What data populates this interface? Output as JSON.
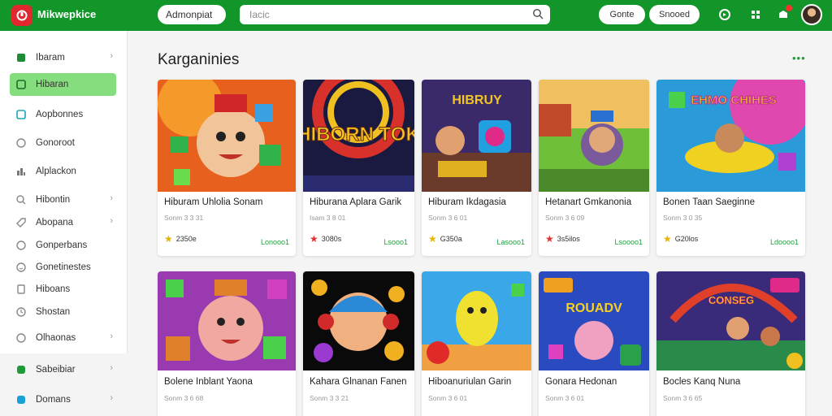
{
  "header": {
    "logo_text": "Mikwepkice",
    "selector_label": "Admonpiat",
    "search_placeholder": "Iacic",
    "btn_a": "Gonte",
    "btn_b": "Snooed"
  },
  "sidebar": {
    "items": [
      {
        "label": "Ibaram",
        "icon": "puzzle-icon",
        "chevron": true,
        "active": false
      },
      {
        "label": "Hibaran",
        "icon": "gamepad-icon",
        "chevron": false,
        "active": true
      },
      {
        "label": "Aopbonnes",
        "icon": "grid-icon",
        "chevron": false,
        "active": false
      },
      {
        "label": "Gonoroot",
        "icon": "circle-icon",
        "chevron": false,
        "active": false
      },
      {
        "label": "Alplackon",
        "icon": "chart-icon",
        "chevron": false,
        "active": false
      },
      {
        "label": "Hibontin",
        "icon": "search-icon",
        "chevron": true,
        "active": false
      },
      {
        "label": "Abopana",
        "icon": "tag-icon",
        "chevron": true,
        "active": false
      },
      {
        "label": "Gonperbans",
        "icon": "circle-icon",
        "chevron": false,
        "active": false
      },
      {
        "label": "Gonetinestes",
        "icon": "smile-icon",
        "chevron": false,
        "active": false
      },
      {
        "label": "Hiboans",
        "icon": "doc-icon",
        "chevron": false,
        "active": false
      },
      {
        "label": "Shostan",
        "icon": "clock-icon",
        "chevron": false,
        "active": false
      },
      {
        "label": "Olhaonas",
        "icon": "circle-icon",
        "chevron": true,
        "active": false
      },
      {
        "label": "Sabeibiar",
        "icon": "green-dot-icon",
        "chevron": true,
        "active": false
      },
      {
        "label": "Domans",
        "icon": "blue-dot-icon",
        "chevron": true,
        "active": false
      }
    ]
  },
  "main": {
    "section_title": "Karganinies",
    "cards": [
      {
        "title": "Hiburam Uhlolia Sonam",
        "sub": "Sonm 3 3 31",
        "rating": "2350e",
        "star": "gold",
        "price": "Lonooo1"
      },
      {
        "title": "Hiburana Aplara Garik",
        "sub": "Isam 3 8 01",
        "rating": "3080s",
        "star": "red",
        "price": "Lsooo1"
      },
      {
        "title": "Hiburam Ikdagasia",
        "sub": "Sonm 3 6 01",
        "rating": "G350a",
        "star": "gold",
        "price": "Lasooo1"
      },
      {
        "title": "Hetanart Gmkanonia",
        "sub": "Sonm 3 6 09",
        "rating": "3s5ilos",
        "star": "red",
        "price": "Lsoooo1"
      },
      {
        "title": "Bonen Taan Saeginne",
        "sub": "Sonm 3 0 35",
        "rating": "G20los",
        "star": "gold",
        "price": "Ldoooo1"
      },
      {
        "title": "Bolene Inblant Yaona",
        "sub": "Sonm 3 6 68",
        "rating": "",
        "star": "",
        "price": ""
      },
      {
        "title": "Kahara Glnanan Fanen",
        "sub": "Sonm 3 3 21",
        "rating": "",
        "star": "",
        "price": ""
      },
      {
        "title": "Hiboanuriulan Garin",
        "sub": "Sonm 3 6 01",
        "rating": "",
        "star": "",
        "price": ""
      },
      {
        "title": "Gonara Hedonan",
        "sub": "Sonm 3 6 01",
        "rating": "",
        "star": "",
        "price": ""
      },
      {
        "title": "Bocles Kanq Nuna",
        "sub": "Sonm 3 6 65",
        "rating": "",
        "star": "",
        "price": ""
      }
    ],
    "thumb_texts": [
      "HIBORN TOK",
      "HIBRUY",
      "EHMO CHIHES",
      "ROUADV",
      "CONSEG"
    ]
  }
}
